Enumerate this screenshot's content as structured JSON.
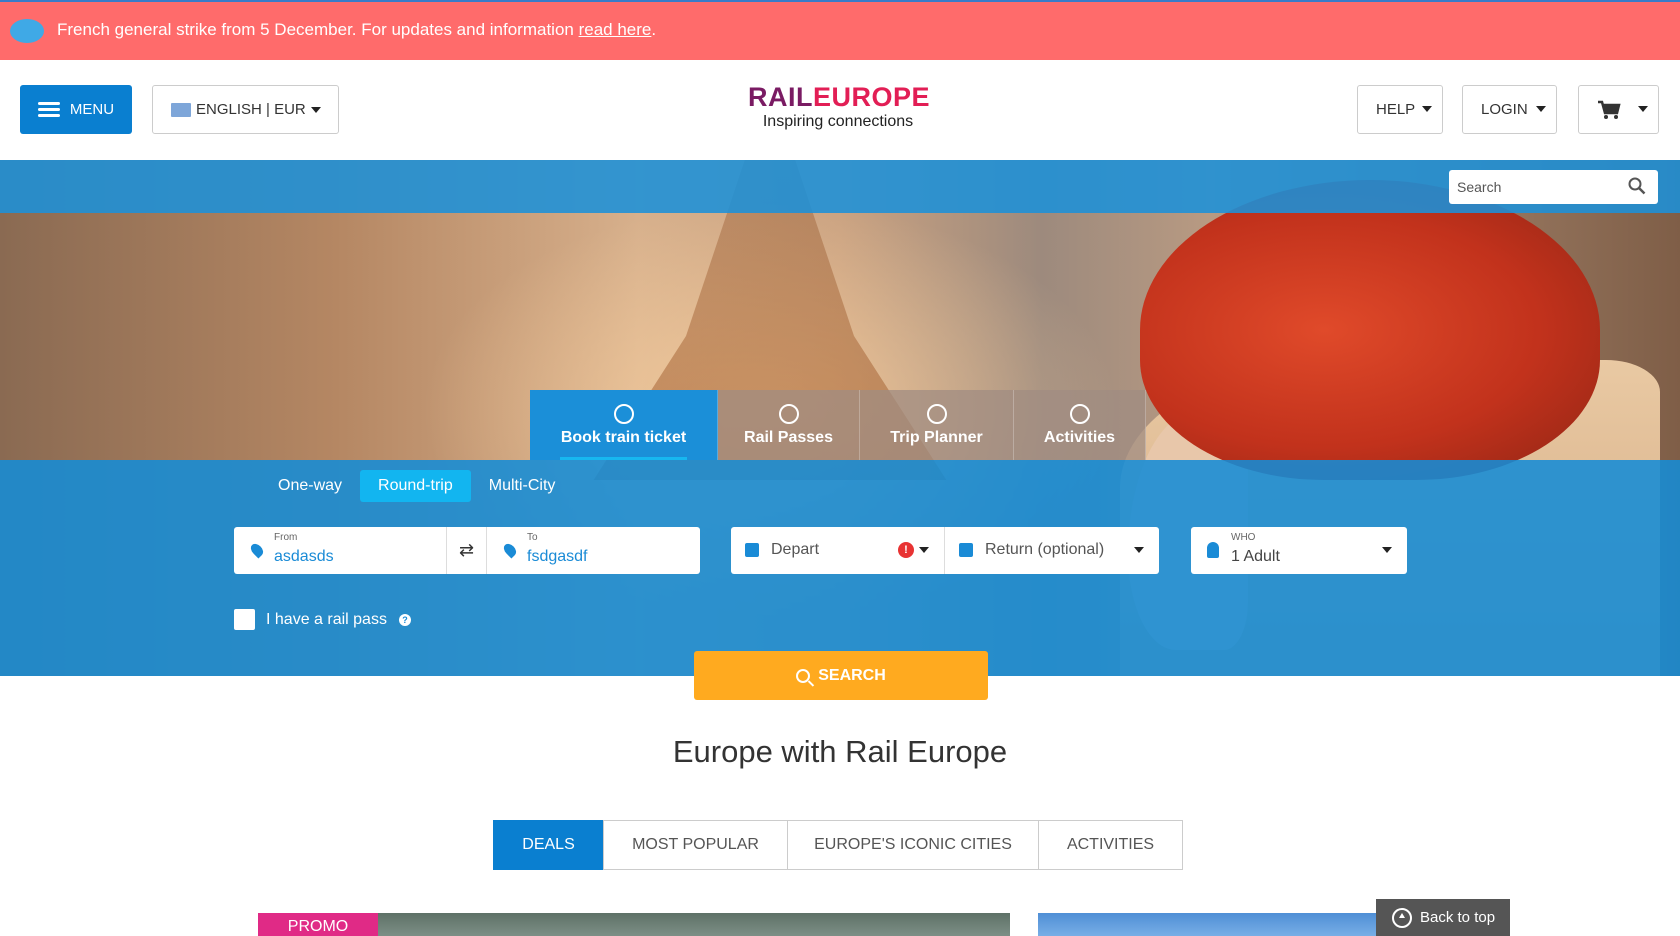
{
  "alert": {
    "text": "French general strike from 5 December. For updates and information ",
    "link": "read here",
    "suffix": "."
  },
  "header": {
    "menu_label": "MENU",
    "language_label": "ENGLISH | EUR",
    "logo": {
      "part1": "RAIL",
      "part2": "EUROPE",
      "tagline": "Inspiring connections"
    },
    "help_label": "HELP",
    "login_label": "LOGIN"
  },
  "search": {
    "placeholder": "Search"
  },
  "product_tabs": [
    {
      "label": "Book train ticket"
    },
    {
      "label": "Rail Passes"
    },
    {
      "label": "Trip Planner"
    },
    {
      "label": "Activities"
    }
  ],
  "trip_types": [
    {
      "label": "One-way"
    },
    {
      "label": "Round-trip"
    },
    {
      "label": "Multi-City"
    }
  ],
  "booking": {
    "from_label": "From",
    "from_value": "asdasds",
    "to_label": "To",
    "to_value": "fsdgasdf",
    "depart_label": "Depart",
    "return_label": "Return (optional)",
    "who_label": "WHO",
    "who_value": "1 Adult",
    "rail_pass_label": "I have a rail pass",
    "search_label": "SEARCH"
  },
  "section_title": "Europe with Rail Europe",
  "content_tabs": [
    {
      "label": "DEALS"
    },
    {
      "label": "MOST POPULAR"
    },
    {
      "label": "EUROPE'S ICONIC CITIES"
    },
    {
      "label": "ACTIVITIES"
    }
  ],
  "promo_label": "PROMO",
  "back_to_top_label": "Back to top",
  "colors": {
    "alert_bg": "#ff6b6b",
    "primary_blue": "#0a7fd0",
    "search_orange": "#ffaa1f",
    "promo_pink": "#e02a86",
    "logo_purple": "#7a1b63",
    "logo_red": "#e21e55"
  }
}
